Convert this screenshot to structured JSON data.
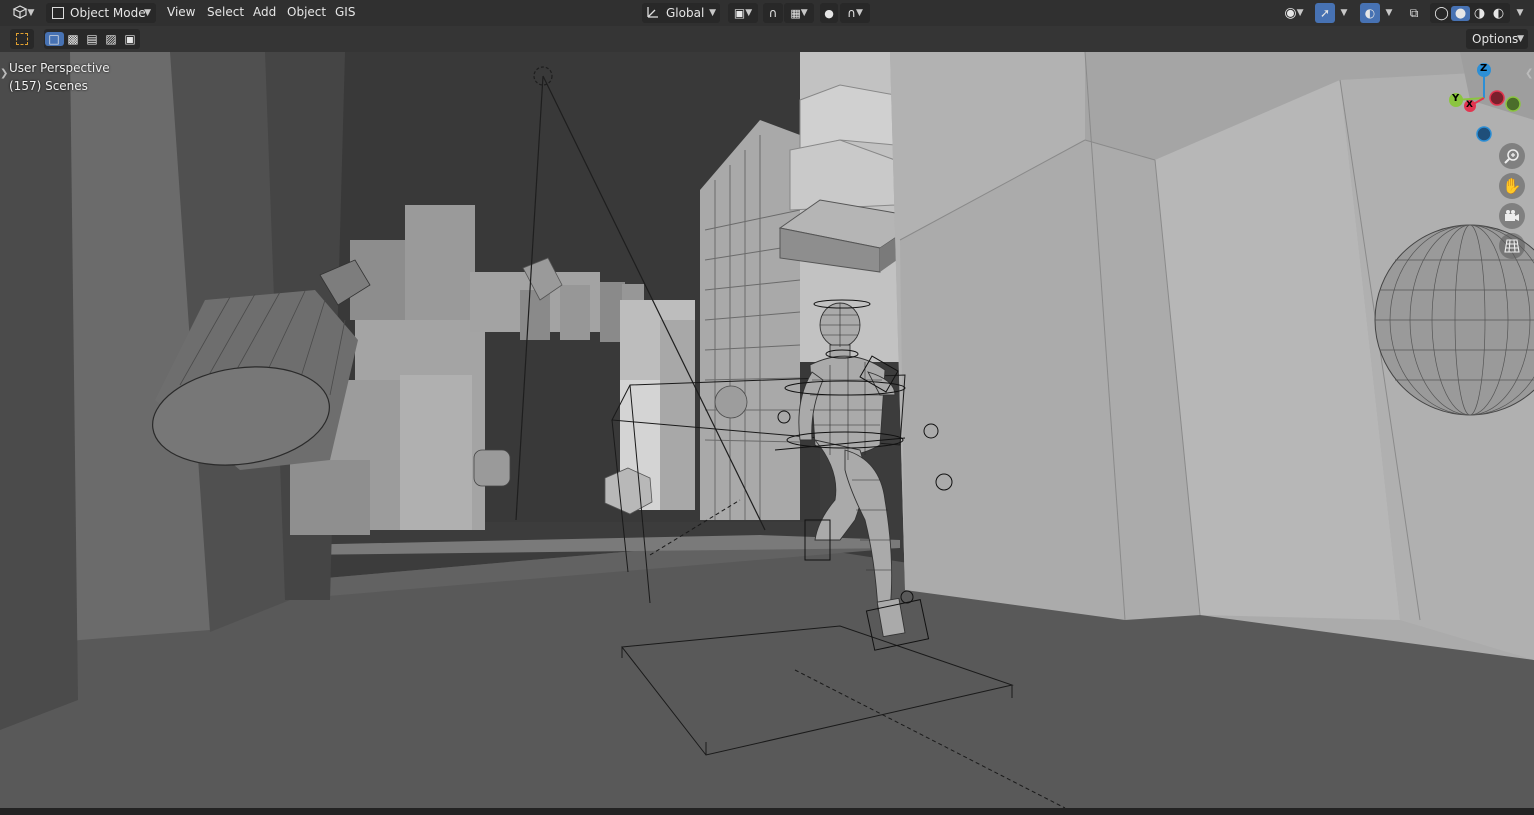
{
  "header": {
    "editor_type_icon": "viewport-editor-icon",
    "mode_label": "Object Mode",
    "menus": [
      "View",
      "Select",
      "Add",
      "Object",
      "GIS"
    ],
    "orientation_label": "Global"
  },
  "tool_header": {
    "options_label": "Options"
  },
  "viewport_info": {
    "view_name": "User Perspective",
    "collection": "(157) Scenes"
  },
  "gizmo": {
    "z_label": "Z",
    "y_label": "Y",
    "x_label": "X",
    "colors": {
      "x": "#e3344f",
      "y": "#8bc53f",
      "z": "#2c8fd6"
    }
  },
  "nav_buttons": [
    "zoom-icon",
    "hand-pan-icon",
    "camera-icon",
    "grid-ortho-icon"
  ],
  "accent_color": "#4772b3"
}
